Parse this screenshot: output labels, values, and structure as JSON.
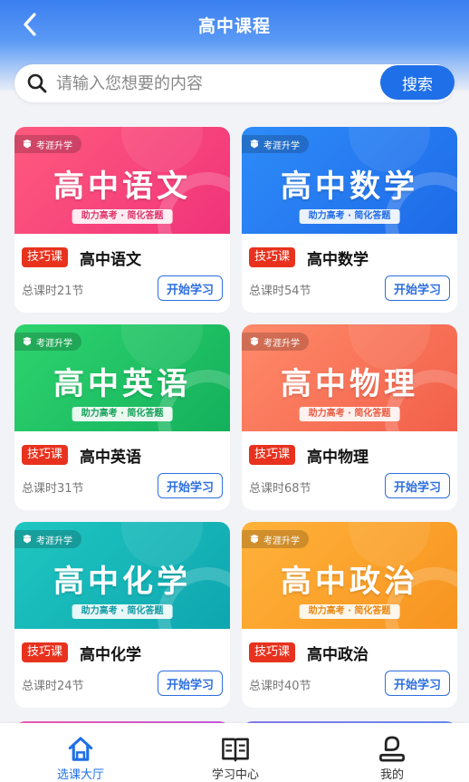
{
  "header": {
    "title": "高中课程"
  },
  "search": {
    "placeholder": "请输入您想要的内容",
    "button_label": "搜索"
  },
  "colors": {
    "primary": "#1f6fe8",
    "badge": "#e8321e"
  },
  "cards": [
    {
      "banner_brand": "考涯升学",
      "banner_title": "高中语文",
      "banner_slogan": "助力高考 · 简化答题",
      "badge": "技巧课",
      "name": "高中语文",
      "lessons": "总课时21节",
      "start_label": "开始学习",
      "gradient": [
        "#ff5a7e",
        "#f0337a"
      ],
      "slogan_color": "#e0346a"
    },
    {
      "banner_brand": "考涯升学",
      "banner_title": "高中数学",
      "banner_slogan": "助力高考 · 简化答题",
      "badge": "技巧课",
      "name": "高中数学",
      "lessons": "总课时54节",
      "start_label": "开始学习",
      "gradient": [
        "#2e8cf8",
        "#1e6ae8"
      ],
      "slogan_color": "#1e6ae8"
    },
    {
      "banner_brand": "考涯升学",
      "banner_title": "高中英语",
      "banner_slogan": "助力高考 · 简化答题",
      "badge": "技巧课",
      "name": "高中英语",
      "lessons": "总课时31节",
      "start_label": "开始学习",
      "gradient": [
        "#2ed46e",
        "#14b05c"
      ],
      "slogan_color": "#14a058"
    },
    {
      "banner_brand": "考涯升学",
      "banner_title": "高中物理",
      "banner_slogan": "助力高考 · 简化答题",
      "badge": "技巧课",
      "name": "高中物理",
      "lessons": "总课时68节",
      "start_label": "开始学习",
      "gradient": [
        "#ff8a6a",
        "#f2604a"
      ],
      "slogan_color": "#e85a40"
    },
    {
      "banner_brand": "考涯升学",
      "banner_title": "高中化学",
      "banner_slogan": "助力高考 · 简化答题",
      "badge": "技巧课",
      "name": "高中化学",
      "lessons": "总课时24节",
      "start_label": "开始学习",
      "gradient": [
        "#1fc6c0",
        "#0ea6b0"
      ],
      "slogan_color": "#0e9aa4"
    },
    {
      "banner_brand": "考涯升学",
      "banner_title": "高中政治",
      "banner_slogan": "助力高考 · 简化答题",
      "badge": "技巧课",
      "name": "高中政治",
      "lessons": "总课时40节",
      "start_label": "开始学习",
      "gradient": [
        "#ffb23a",
        "#f79420"
      ],
      "slogan_color": "#e8860e"
    }
  ],
  "tabs": [
    {
      "label": "选课大厅",
      "icon": "home-icon",
      "active": true
    },
    {
      "label": "学习中心",
      "icon": "book-icon",
      "active": false
    },
    {
      "label": "我的",
      "icon": "profile-icon",
      "active": false
    }
  ]
}
